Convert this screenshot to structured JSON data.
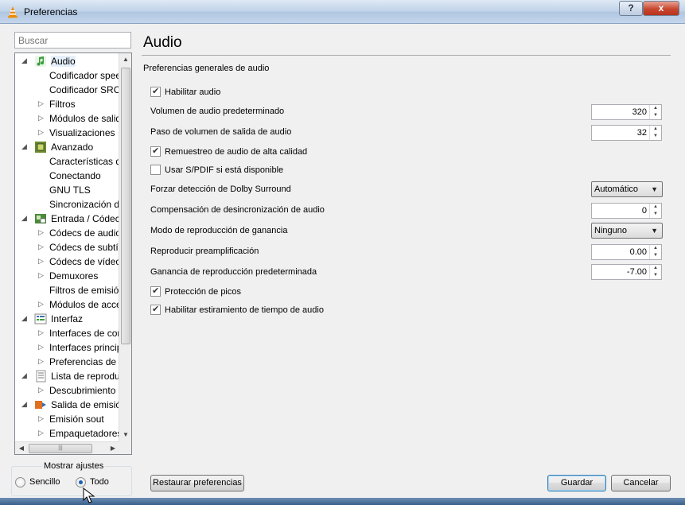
{
  "window": {
    "title": "Preferencias",
    "help_label": "?",
    "close_label": "x"
  },
  "sidebar": {
    "search_placeholder": "Buscar",
    "items": [
      {
        "label": "Audio",
        "level": 0,
        "expanded": true,
        "icon": "music-note-icon",
        "selected": true
      },
      {
        "label": "Codificador speex",
        "level": 1
      },
      {
        "label": "Codificador SRC",
        "level": 1
      },
      {
        "label": "Filtros",
        "level": 1,
        "collapsed": true
      },
      {
        "label": "Módulos de salida",
        "level": 1,
        "collapsed": true
      },
      {
        "label": "Visualizaciones",
        "level": 1,
        "collapsed": true
      },
      {
        "label": "Avanzado",
        "level": 0,
        "expanded": true,
        "icon": "chip-icon"
      },
      {
        "label": "Características de rendimiento",
        "level": 1
      },
      {
        "label": "Conectando",
        "level": 1
      },
      {
        "label": "GNU TLS",
        "level": 1
      },
      {
        "label": "Sincronización de",
        "level": 1
      },
      {
        "label": "Entrada / Códecs",
        "level": 0,
        "expanded": true,
        "icon": "input-codecs-icon"
      },
      {
        "label": "Códecs de audio",
        "level": 1,
        "collapsed": true
      },
      {
        "label": "Códecs de subtítulos",
        "level": 1,
        "collapsed": true
      },
      {
        "label": "Códecs de vídeo",
        "level": 1,
        "collapsed": true
      },
      {
        "label": "Demuxores",
        "level": 1,
        "collapsed": true
      },
      {
        "label": "Filtros de emisión",
        "level": 1
      },
      {
        "label": "Módulos de acceso",
        "level": 1,
        "collapsed": true
      },
      {
        "label": "Interfaz",
        "level": 0,
        "expanded": true,
        "icon": "interface-icon"
      },
      {
        "label": "Interfaces de control",
        "level": 1,
        "collapsed": true
      },
      {
        "label": "Interfaces principales",
        "level": 1,
        "collapsed": true
      },
      {
        "label": "Preferencias de atajos",
        "level": 1,
        "collapsed": true
      },
      {
        "label": "Lista de reproducción",
        "level": 0,
        "expanded": true,
        "icon": "playlist-icon"
      },
      {
        "label": "Descubrimiento",
        "level": 1,
        "collapsed": true
      },
      {
        "label": "Salida de emisión",
        "level": 0,
        "expanded": true,
        "icon": "stream-output-icon"
      },
      {
        "label": "Emisión sout",
        "level": 1,
        "collapsed": true
      },
      {
        "label": "Empaquetadores",
        "level": 1,
        "collapsed": true
      }
    ],
    "show_settings_label": "Mostrar ajustes",
    "simple_label": "Sencillo",
    "all_label": "Todo",
    "selected_mode": "Todo"
  },
  "main": {
    "title": "Audio",
    "section": "Preferencias generales de audio",
    "enable_audio": {
      "label": "Habilitar audio",
      "checked": true
    },
    "default_volume": {
      "label": "Volumen de audio predeterminado",
      "value": "320"
    },
    "volume_step": {
      "label": "Paso de volumen de salida de audio",
      "value": "32"
    },
    "hq_resampling": {
      "label": "Remuestreo de audio de alta calidad",
      "checked": true
    },
    "spdif": {
      "label": "Usar S/PDIF si está disponible",
      "checked": false
    },
    "dolby": {
      "label": "Forzar detección de Dolby Surround",
      "value": "Automático"
    },
    "desync": {
      "label": "Compensación de desincronización de audio",
      "value": "0"
    },
    "replay_gain_mode": {
      "label": "Modo de reproducción de ganancia",
      "value": "Ninguno"
    },
    "preamp": {
      "label": "Reproducir preamplificación",
      "value": "0.00"
    },
    "default_gain": {
      "label": "Ganancia de reproducción predeterminada",
      "value": "-7.00"
    },
    "peak_protection": {
      "label": "Protección de picos",
      "checked": true
    },
    "time_stretch": {
      "label": "Habilitar estiramiento de tiempo de audio",
      "checked": true
    }
  },
  "footer": {
    "reset_label": "Restaurar preferencias",
    "save_label": "Guardar",
    "cancel_label": "Cancelar"
  }
}
